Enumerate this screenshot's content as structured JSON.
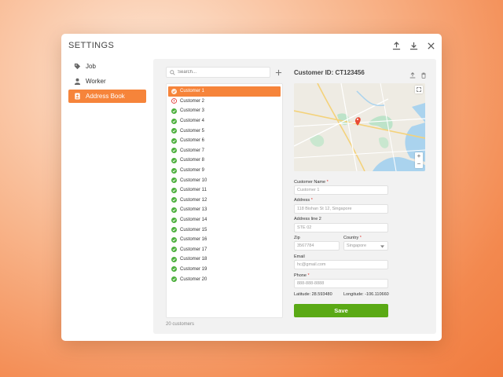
{
  "window": {
    "title": "SETTINGS",
    "actions": [
      {
        "name": "upload-icon"
      },
      {
        "name": "download-icon"
      },
      {
        "name": "close-icon"
      }
    ]
  },
  "sidebar": {
    "items": [
      {
        "label": "Job",
        "icon": "tag-icon",
        "active": false
      },
      {
        "label": "Worker",
        "icon": "person-icon",
        "active": false
      },
      {
        "label": "Address Book",
        "icon": "address-book-icon",
        "active": true
      }
    ]
  },
  "search": {
    "placeholder": "Search..."
  },
  "customers": [
    {
      "name": "Customer 1",
      "status": "selected"
    },
    {
      "name": "Customer 2",
      "status": "warning"
    },
    {
      "name": "Customer 3",
      "status": "ok"
    },
    {
      "name": "Customer 4",
      "status": "ok"
    },
    {
      "name": "Customer 5",
      "status": "ok"
    },
    {
      "name": "Customer 6",
      "status": "ok"
    },
    {
      "name": "Customer 7",
      "status": "ok"
    },
    {
      "name": "Customer 8",
      "status": "ok"
    },
    {
      "name": "Customer 9",
      "status": "ok"
    },
    {
      "name": "Customer 10",
      "status": "ok"
    },
    {
      "name": "Customer 11",
      "status": "ok"
    },
    {
      "name": "Customer 12",
      "status": "ok"
    },
    {
      "name": "Customer 13",
      "status": "ok"
    },
    {
      "name": "Customer 14",
      "status": "ok"
    },
    {
      "name": "Customer 15",
      "status": "ok"
    },
    {
      "name": "Customer 16",
      "status": "ok"
    },
    {
      "name": "Customer 17",
      "status": "ok"
    },
    {
      "name": "Customer 18",
      "status": "ok"
    },
    {
      "name": "Customer 19",
      "status": "ok"
    },
    {
      "name": "Customer 20",
      "status": "ok"
    }
  ],
  "list_footer": "20 customers",
  "detail": {
    "customer_id": "Customer ID: CT123456",
    "customer_name_label": "Customer Name",
    "customer_name_value": "Customer 1",
    "address_label": "Address",
    "address_value": "118 Bishan St 12, Singapore",
    "address2_label": "Address line 2",
    "address2_value": "STE 02",
    "zip_label": "Zip",
    "zip_value": "3567784",
    "country_label": "Country",
    "country_value": "Singapore",
    "email_label": "Email",
    "email_value": "hc@gmail.com",
    "phone_label": "Phone",
    "phone_value": "888-888-8888",
    "latitude": "Latitude: 28.593480",
    "longitude": "Longitude: -106.110660",
    "save_label": "Save"
  },
  "colors": {
    "accent": "#f6843a",
    "ok": "#4caf3c",
    "warning": "#e0302b",
    "save": "#5aa915"
  }
}
